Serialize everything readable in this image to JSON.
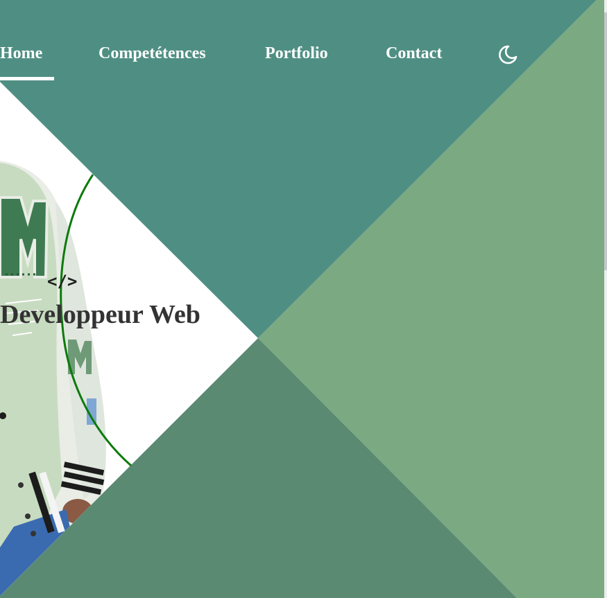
{
  "colors": {
    "teal": "#4f8f83",
    "sage": "#7ba981",
    "forest": "#5a8a72",
    "white": "#ffffff",
    "arc": "#0b7a0b",
    "heading": "#333333"
  },
  "nav": {
    "items": [
      {
        "label": "Home",
        "active": true
      },
      {
        "label": "Competétences",
        "active": false
      },
      {
        "label": "Portfolio",
        "active": false
      },
      {
        "label": "Contact",
        "active": false
      }
    ],
    "theme_icon": "moon-icon"
  },
  "hero": {
    "code_tag": "</>",
    "title": "Developpeur Web",
    "photo": "portrait-photo",
    "jacket_letter": "M"
  }
}
